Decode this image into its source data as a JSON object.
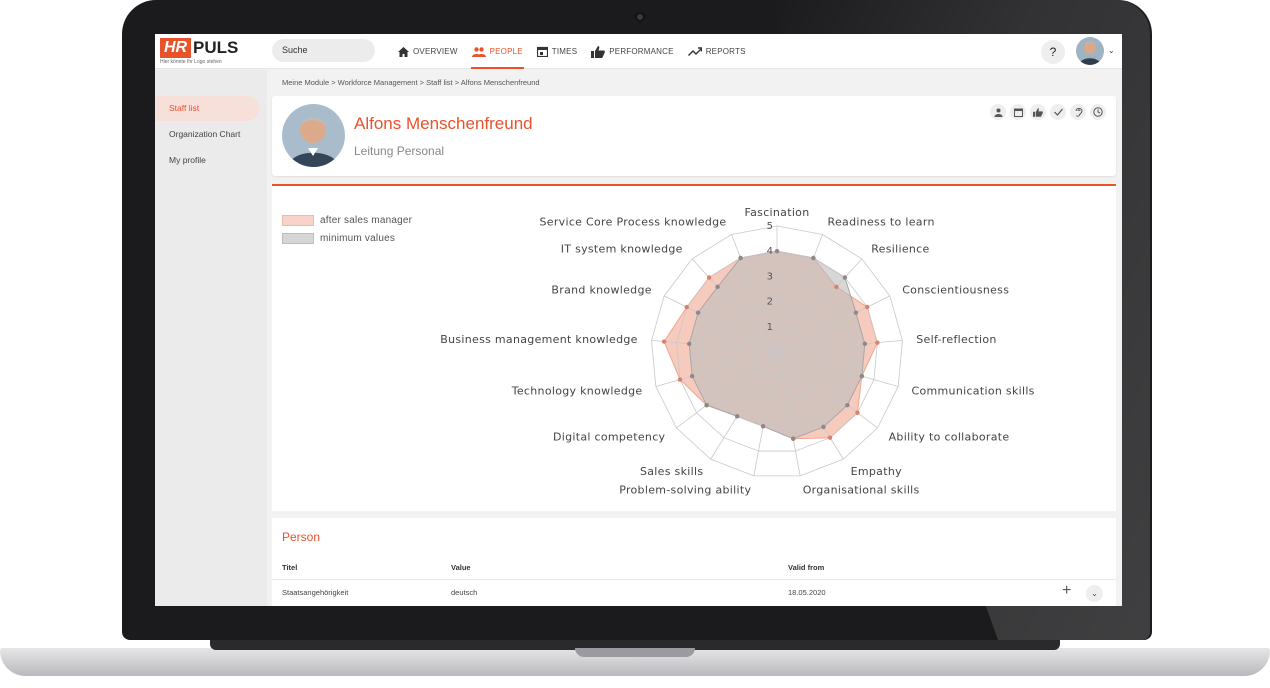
{
  "app": {
    "logo_hr": "HR",
    "logo_puls": "PULS",
    "logo_tagline": "Hier könnte Ihr Logo stehen",
    "search_placeholder": "Suche",
    "help_label": "?"
  },
  "nav": [
    {
      "label": "OVERVIEW",
      "icon": "home-icon",
      "active": false
    },
    {
      "label": "PEOPLE",
      "icon": "people-icon",
      "active": true
    },
    {
      "label": "TIMES",
      "icon": "calendar-icon",
      "active": false
    },
    {
      "label": "PERFORMANCE",
      "icon": "thumbs-up-icon",
      "active": false
    },
    {
      "label": "REPORTS",
      "icon": "trending-icon",
      "active": false
    }
  ],
  "sidebar": {
    "items": [
      {
        "label": "Staff list",
        "active": true
      },
      {
        "label": "Organization Chart",
        "active": false
      },
      {
        "label": "My profile",
        "active": false
      }
    ]
  },
  "breadcrumb": "Meine Module > Workforce Management > Staff list > Alfons Menschenfreund",
  "profile": {
    "name": "Alfons Menschenfreund",
    "role": "Leitung Personal",
    "icons": [
      "person-icon",
      "calendar-icon",
      "thumbs-up-icon",
      "check-icon",
      "ear-icon",
      "clock-icon"
    ]
  },
  "chart_data": {
    "type": "radar",
    "axes": [
      "Fascination",
      "Readiness to learn",
      "Resilience",
      "Conscientiousness",
      "Self-reflection",
      "Communication skills",
      "Ability to collaborate",
      "Empathy",
      "Organisational skills",
      "Problem-solving ability",
      "Sales skills",
      "Digital competency",
      "Technology knowledge",
      "Business management knowledge",
      "Brand knowledge",
      "IT system knowledge",
      "Service Core Process knowledge"
    ],
    "rlim": [
      0,
      5
    ],
    "ticks": [
      "1",
      "2",
      "3",
      "4",
      "5"
    ],
    "series": [
      {
        "name": "after sales manager",
        "color": "#f4b8a8",
        "values": [
          4,
          4,
          3.5,
          4,
          4,
          3.5,
          4,
          4,
          3.5,
          3,
          3,
          3.5,
          4,
          4.5,
          4,
          4,
          4
        ]
      },
      {
        "name": "minimum values",
        "color": "#bdbdbd",
        "values": [
          4,
          4,
          4,
          3.5,
          3.5,
          3.5,
          3.5,
          3.5,
          3.5,
          3,
          3,
          3.5,
          3.5,
          3.5,
          3.5,
          3.5,
          4
        ]
      }
    ]
  },
  "person": {
    "section_title": "Person",
    "columns": [
      "Titel",
      "Value",
      "Valid from"
    ],
    "rows": [
      [
        "Staatsangehörigkeit",
        "deutsch",
        "18.05.2020"
      ]
    ]
  },
  "colors": {
    "accent": "#e8532c"
  }
}
